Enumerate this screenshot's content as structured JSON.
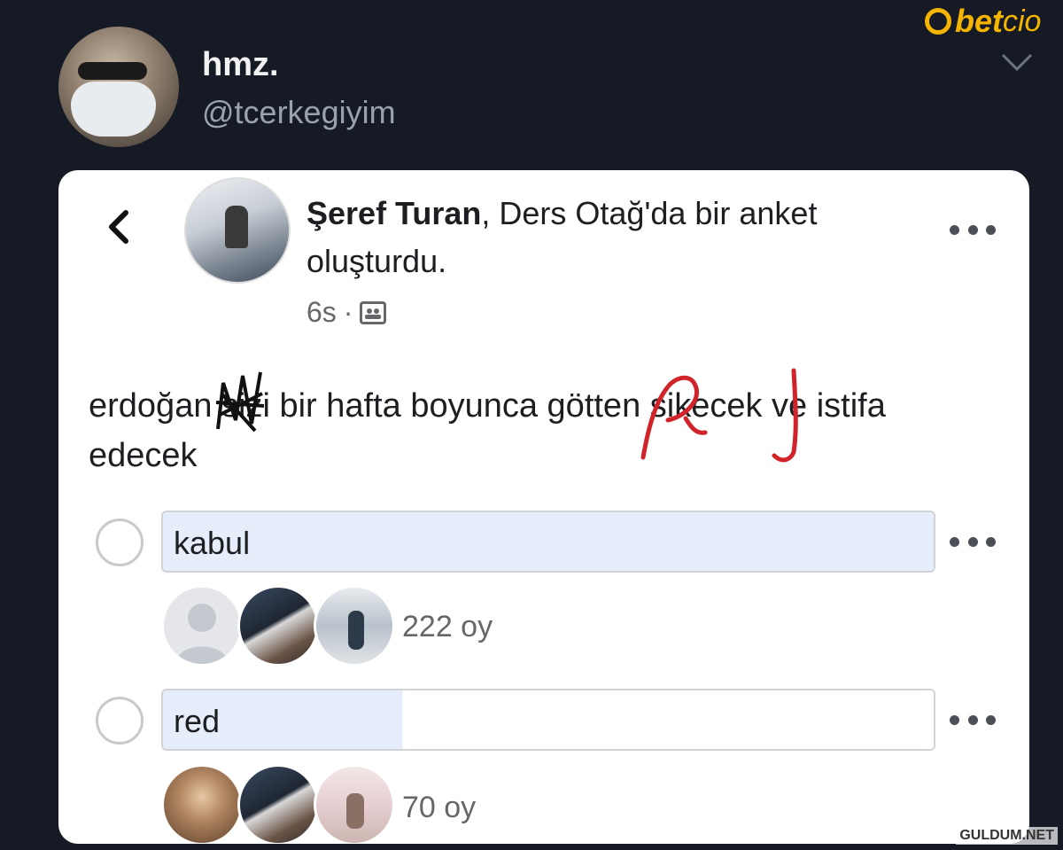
{
  "tweet": {
    "name": "hmz.",
    "handle": "@tcerkegiyim"
  },
  "brand": {
    "logo_text": "bet",
    "logo_text2": "cio",
    "color": "#f5b400"
  },
  "post": {
    "author": "Şeref Turan",
    "title_rest": ", Ders Otağ'da bir anket oluşturdu.",
    "time": "6s",
    "separator": "·",
    "text": "erdoğan sizi bir hafta boyunca götten sikecek ve istifa edecek",
    "options": [
      {
        "label": "kabul",
        "votes_text": "222 oy",
        "fill": 1.0
      },
      {
        "label": "red",
        "votes_text": "70 oy",
        "fill": 0.31
      }
    ]
  },
  "watermark": "GULDUM.NET",
  "icons": [
    "back-chevron-icon",
    "more-dots-icon",
    "group-icon",
    "chevron-down-icon"
  ]
}
